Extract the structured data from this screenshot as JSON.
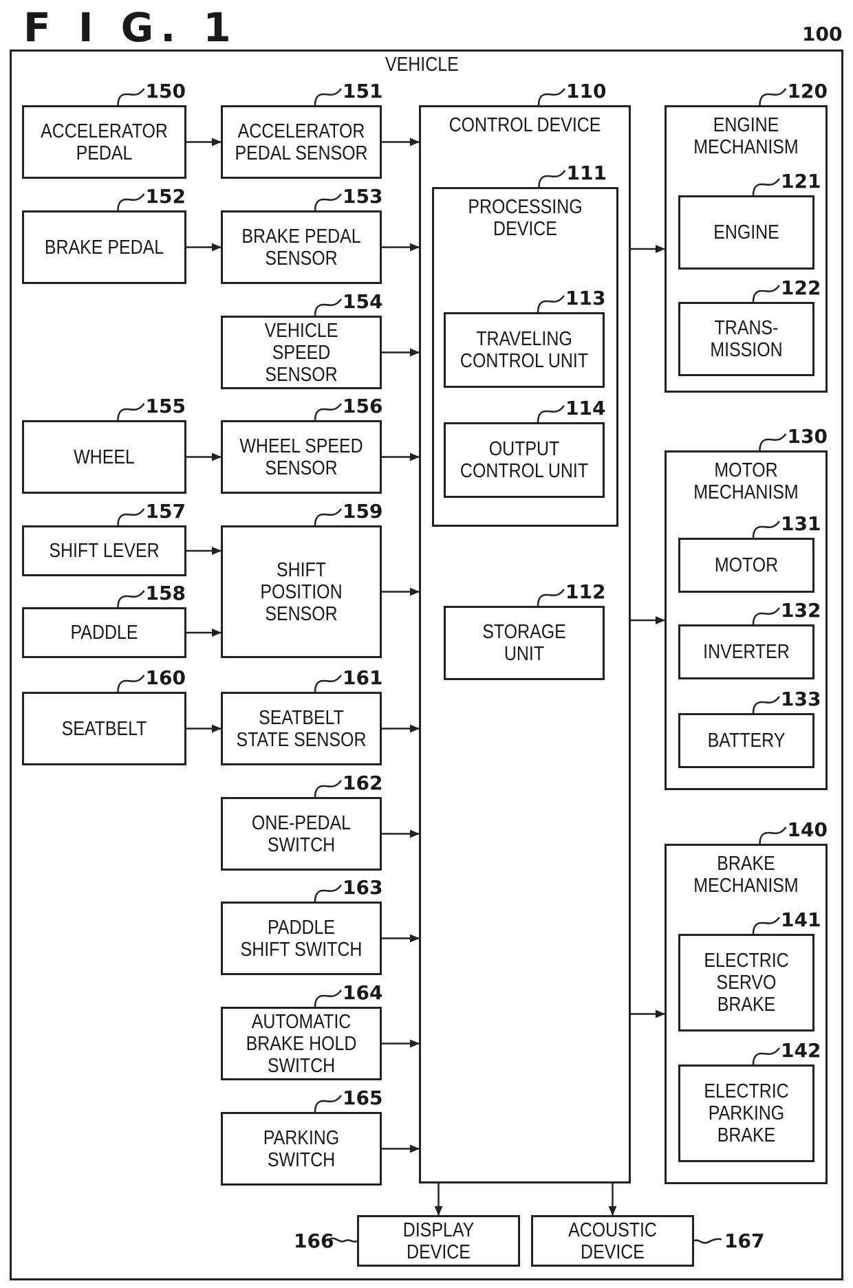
{
  "figure": {
    "title": "F I G. 1",
    "vehicle": {
      "ref": "100",
      "label": "VEHICLE"
    }
  },
  "blocks": {
    "control_device": {
      "ref": "110",
      "label": "CONTROL DEVICE"
    },
    "processing_device": {
      "ref": "111",
      "label": "PROCESSING\nDEVICE"
    },
    "storage_unit": {
      "ref": "112",
      "label": "STORAGE\nUNIT"
    },
    "traveling_control_unit": {
      "ref": "113",
      "label": "TRAVELING\nCONTROL UNIT"
    },
    "output_control_unit": {
      "ref": "114",
      "label": "OUTPUT\nCONTROL UNIT"
    },
    "engine_mechanism": {
      "ref": "120",
      "label": "ENGINE\nMECHANISM"
    },
    "engine": {
      "ref": "121",
      "label": "ENGINE"
    },
    "transmission": {
      "ref": "122",
      "label": "TRANS-\nMISSION"
    },
    "motor_mechanism": {
      "ref": "130",
      "label": "MOTOR\nMECHANISM"
    },
    "motor": {
      "ref": "131",
      "label": "MOTOR"
    },
    "inverter": {
      "ref": "132",
      "label": "INVERTER"
    },
    "battery": {
      "ref": "133",
      "label": "BATTERY"
    },
    "brake_mechanism": {
      "ref": "140",
      "label": "BRAKE\nMECHANISM"
    },
    "electric_servo_brake": {
      "ref": "141",
      "label": "ELECTRIC\nSERVO\nBRAKE"
    },
    "electric_parking_brake": {
      "ref": "142",
      "label": "ELECTRIC\nPARKING\nBRAKE"
    },
    "accelerator_pedal": {
      "ref": "150",
      "label": "ACCELERATOR\nPEDAL"
    },
    "accelerator_pedal_sensor": {
      "ref": "151",
      "label": "ACCELERATOR\nPEDAL SENSOR"
    },
    "brake_pedal": {
      "ref": "152",
      "label": "BRAKE PEDAL"
    },
    "brake_pedal_sensor": {
      "ref": "153",
      "label": "BRAKE PEDAL\nSENSOR"
    },
    "vehicle_speed_sensor": {
      "ref": "154",
      "label": "VEHICLE SPEED\nSENSOR"
    },
    "wheel": {
      "ref": "155",
      "label": "WHEEL"
    },
    "wheel_speed_sensor": {
      "ref": "156",
      "label": "WHEEL SPEED\nSENSOR"
    },
    "shift_lever": {
      "ref": "157",
      "label": "SHIFT LEVER"
    },
    "paddle": {
      "ref": "158",
      "label": "PADDLE"
    },
    "shift_position_sensor": {
      "ref": "159",
      "label": "SHIFT\nPOSITION\nSENSOR"
    },
    "seatbelt": {
      "ref": "160",
      "label": "SEATBELT"
    },
    "seatbelt_state_sensor": {
      "ref": "161",
      "label": "SEATBELT\nSTATE SENSOR"
    },
    "one_pedal_switch": {
      "ref": "162",
      "label": "ONE-PEDAL\nSWITCH"
    },
    "paddle_shift_switch": {
      "ref": "163",
      "label": "PADDLE\nSHIFT SWITCH"
    },
    "automatic_brake_hold_switch": {
      "ref": "164",
      "label": "AUTOMATIC\nBRAKE HOLD\nSWITCH"
    },
    "parking_switch": {
      "ref": "165",
      "label": "PARKING\nSWITCH"
    },
    "display_device": {
      "ref": "166",
      "label": "DISPLAY\nDEVICE"
    },
    "acoustic_device": {
      "ref": "167",
      "label": "ACOUSTIC\nDEVICE"
    }
  },
  "connections": [
    {
      "from": "accelerator_pedal",
      "to": "accelerator_pedal_sensor"
    },
    {
      "from": "accelerator_pedal_sensor",
      "to": "control_device"
    },
    {
      "from": "brake_pedal",
      "to": "brake_pedal_sensor"
    },
    {
      "from": "brake_pedal_sensor",
      "to": "control_device"
    },
    {
      "from": "vehicle_speed_sensor",
      "to": "control_device"
    },
    {
      "from": "wheel",
      "to": "wheel_speed_sensor"
    },
    {
      "from": "wheel_speed_sensor",
      "to": "control_device"
    },
    {
      "from": "shift_lever",
      "to": "shift_position_sensor"
    },
    {
      "from": "paddle",
      "to": "shift_position_sensor"
    },
    {
      "from": "shift_position_sensor",
      "to": "control_device"
    },
    {
      "from": "seatbelt",
      "to": "seatbelt_state_sensor"
    },
    {
      "from": "seatbelt_state_sensor",
      "to": "control_device"
    },
    {
      "from": "one_pedal_switch",
      "to": "control_device"
    },
    {
      "from": "paddle_shift_switch",
      "to": "control_device"
    },
    {
      "from": "automatic_brake_hold_switch",
      "to": "control_device"
    },
    {
      "from": "parking_switch",
      "to": "control_device"
    },
    {
      "from": "control_device",
      "to": "engine_mechanism"
    },
    {
      "from": "control_device",
      "to": "motor_mechanism"
    },
    {
      "from": "control_device",
      "to": "brake_mechanism"
    },
    {
      "from": "control_device",
      "to": "display_device"
    },
    {
      "from": "control_device",
      "to": "acoustic_device"
    }
  ]
}
